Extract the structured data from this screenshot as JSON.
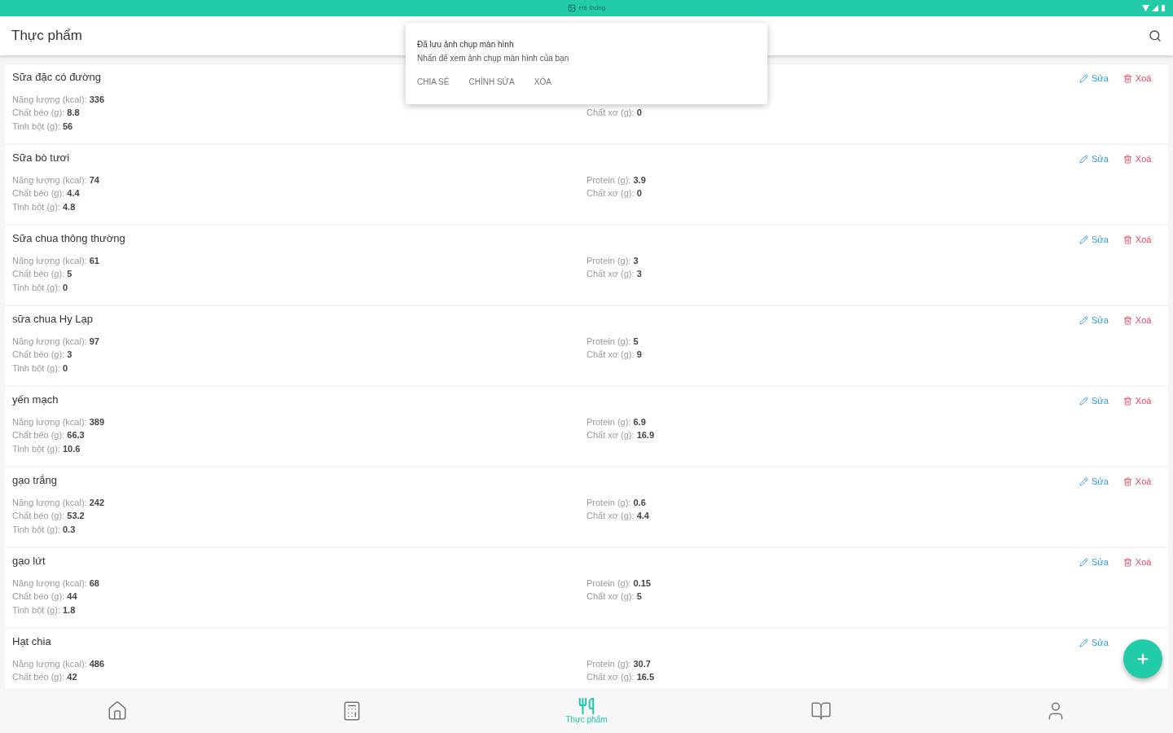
{
  "status_bar": {
    "notification": "Hệ thống"
  },
  "app_bar": {
    "title": "Thực phẩm"
  },
  "foods": [
    {
      "name": "Sữa đặc có đường",
      "left": [
        {
          "label": "Năng lượng (kcal):",
          "value": "336"
        },
        {
          "label": "Chất béo (g):",
          "value": "8.8"
        },
        {
          "label": "Tinh bột (g):",
          "value": "56"
        }
      ],
      "right": [
        {
          "label": "Chất xơ (g):",
          "value": "0"
        }
      ],
      "actions": [
        {
          "kind": "edit",
          "label": "Sửa"
        },
        {
          "kind": "delete",
          "label": "Xoá"
        }
      ]
    },
    {
      "name": "Sữa bò tươi",
      "left": [
        {
          "label": "Năng lượng (kcal):",
          "value": "74"
        },
        {
          "label": "Chất béo (g):",
          "value": "4.4"
        },
        {
          "label": "Tinh bột (g):",
          "value": "4.8"
        }
      ],
      "right": [
        {
          "label": "Protein (g):",
          "value": "3.9"
        },
        {
          "label": "Chất xơ (g):",
          "value": "0"
        }
      ],
      "actions": [
        {
          "kind": "edit",
          "label": "Sửa"
        },
        {
          "kind": "delete",
          "label": "Xoá"
        }
      ]
    },
    {
      "name": "Sữa chua thông thường",
      "left": [
        {
          "label": "Năng lượng (kcal):",
          "value": "61"
        },
        {
          "label": "Chất béo (g):",
          "value": "5"
        },
        {
          "label": "Tinh bột (g):",
          "value": "0"
        }
      ],
      "right": [
        {
          "label": "Protein (g):",
          "value": "3"
        },
        {
          "label": "Chất xơ (g):",
          "value": "3"
        }
      ],
      "actions": [
        {
          "kind": "edit",
          "label": "Sửa"
        },
        {
          "kind": "delete",
          "label": "Xoá"
        }
      ]
    },
    {
      "name": "sữa chua Hy Lạp",
      "left": [
        {
          "label": "Năng lượng (kcal):",
          "value": "97"
        },
        {
          "label": "Chất béo (g):",
          "value": "3"
        },
        {
          "label": "Tinh bột (g):",
          "value": "0"
        }
      ],
      "right": [
        {
          "label": "Protein (g):",
          "value": "5"
        },
        {
          "label": "Chất xơ (g):",
          "value": "9"
        }
      ],
      "actions": [
        {
          "kind": "edit",
          "label": "Sửa"
        },
        {
          "kind": "delete",
          "label": "Xoá"
        }
      ]
    },
    {
      "name": "yến mạch",
      "left": [
        {
          "label": "Năng lượng (kcal):",
          "value": "389"
        },
        {
          "label": "Chất béo (g):",
          "value": "66.3"
        },
        {
          "label": "Tinh bột (g):",
          "value": "10.6"
        }
      ],
      "right": [
        {
          "label": "Protein (g):",
          "value": "6.9"
        },
        {
          "label": "Chất xơ (g):",
          "value": "16.9"
        }
      ],
      "actions": [
        {
          "kind": "edit",
          "label": "Sửa"
        },
        {
          "kind": "delete",
          "label": "Xoá"
        }
      ]
    },
    {
      "name": "gạo trắng",
      "left": [
        {
          "label": "Năng lượng (kcal):",
          "value": "242"
        },
        {
          "label": "Chất béo (g):",
          "value": "53.2"
        },
        {
          "label": "Tinh bột (g):",
          "value": "0.3"
        }
      ],
      "right": [
        {
          "label": "Protein (g):",
          "value": "0.6"
        },
        {
          "label": "Chất xơ (g):",
          "value": "4.4"
        }
      ],
      "actions": [
        {
          "kind": "edit",
          "label": "Sửa"
        },
        {
          "kind": "delete",
          "label": "Xoá"
        }
      ]
    },
    {
      "name": "gạo lứt",
      "left": [
        {
          "label": "Năng lượng (kcal):",
          "value": "68"
        },
        {
          "label": "Chất béo (g):",
          "value": "44"
        },
        {
          "label": "Tinh bột (g):",
          "value": "1.8"
        }
      ],
      "right": [
        {
          "label": "Protein (g):",
          "value": "0.15"
        },
        {
          "label": "Chất xơ (g):",
          "value": "5"
        }
      ],
      "actions": [
        {
          "kind": "edit",
          "label": "Sửa"
        },
        {
          "kind": "delete",
          "label": "Xoá"
        }
      ]
    },
    {
      "name": "Hạt chia",
      "left": [
        {
          "label": "Năng lượng (kcal):",
          "value": "486"
        },
        {
          "label": "Chất béo (g):",
          "value": "42"
        }
      ],
      "right": [
        {
          "label": "Protein (g):",
          "value": "30.7"
        },
        {
          "label": "Chất xơ (g):",
          "value": "16.5"
        }
      ],
      "actions": [
        {
          "kind": "edit",
          "label": "Sửa"
        }
      ]
    }
  ],
  "notification": {
    "title": "Đã lưu ảnh chụp màn hình",
    "text": "Nhấn để xem ảnh chụp màn hình của bạn",
    "actions": [
      "CHIA SẺ",
      "CHỈNH SỬA",
      "XÓA"
    ]
  },
  "bottom_nav": [
    {
      "kind": "home",
      "selected": false
    },
    {
      "kind": "report",
      "selected": false
    },
    {
      "kind": "food",
      "selected": true,
      "label": "Thực phẩm"
    },
    {
      "kind": "book",
      "selected": false
    },
    {
      "kind": "profile",
      "selected": false
    }
  ]
}
